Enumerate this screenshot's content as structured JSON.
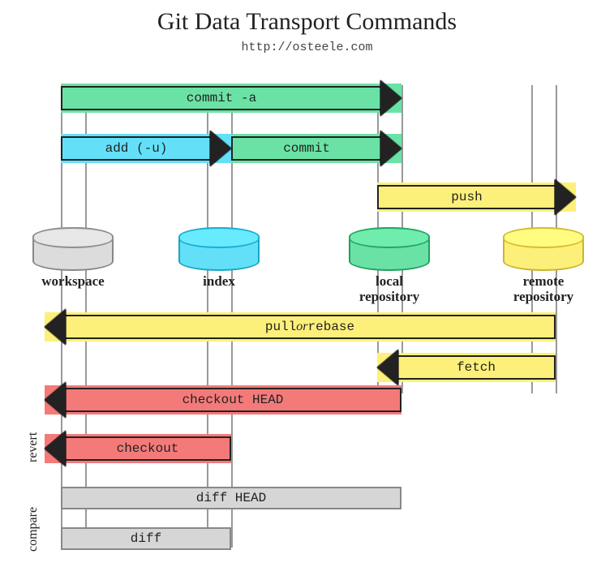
{
  "title": "Git Data Transport Commands",
  "subtitle": "http://osteele.com",
  "locations": {
    "workspace": {
      "label": "workspace"
    },
    "index": {
      "label": "index"
    },
    "local_repo": {
      "label": "local repository"
    },
    "remote_repo": {
      "label": "remote repository"
    }
  },
  "arrows": {
    "commit_a": {
      "label": "commit -a",
      "from": "workspace",
      "to": "local_repo",
      "dir": "right",
      "color": "green"
    },
    "add": {
      "label": "add (-u)",
      "from": "workspace",
      "to": "index",
      "dir": "right",
      "color": "cyan"
    },
    "commit": {
      "label": "commit",
      "from": "index",
      "to": "local_repo",
      "dir": "right",
      "color": "green"
    },
    "push": {
      "label": "push",
      "from": "local_repo",
      "to": "remote_repo",
      "dir": "right",
      "color": "yellow"
    },
    "pull_rebase": {
      "label_pre": "pull",
      "label_mid": " or ",
      "label_post": "rebase",
      "from": "remote_repo",
      "to": "workspace",
      "dir": "left",
      "color": "yellow"
    },
    "fetch": {
      "label": "fetch",
      "from": "remote_repo",
      "to": "local_repo",
      "dir": "left",
      "color": "yellow"
    },
    "checkout_head": {
      "label": "checkout HEAD",
      "from": "local_repo",
      "to": "workspace",
      "dir": "left",
      "color": "red"
    },
    "checkout": {
      "label": "checkout",
      "from": "index",
      "to": "workspace",
      "dir": "left",
      "color": "red"
    }
  },
  "compare": {
    "diff_head": {
      "label": "diff HEAD",
      "from": "workspace",
      "to": "local_repo"
    },
    "diff": {
      "label": "diff",
      "from": "workspace",
      "to": "index"
    }
  },
  "side_labels": {
    "revert": "revert",
    "compare": "compare"
  }
}
